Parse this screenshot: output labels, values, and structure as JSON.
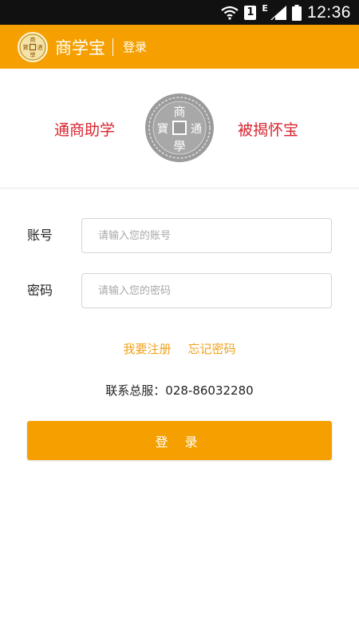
{
  "status_bar": {
    "time": "12:36",
    "sim_slot": "1",
    "network_type": "E",
    "icons": [
      "wifi-icon",
      "sim-icon",
      "signal-icon",
      "battery-icon"
    ]
  },
  "app_bar": {
    "app_name": "商学宝",
    "page_title": "登录",
    "logo_chars": [
      "商",
      "寶",
      "通",
      "學"
    ]
  },
  "banner": {
    "slogan_left": "通商助学",
    "slogan_right": "被揭怀宝",
    "seal_chars": [
      "商",
      "寶",
      "通",
      "學"
    ]
  },
  "form": {
    "account_label": "账号",
    "account_placeholder": "请输入您的账号",
    "account_value": "",
    "password_label": "密码",
    "password_placeholder": "请输入您的密码",
    "password_value": ""
  },
  "links": {
    "register": "我要注册",
    "forgot_password": "忘记密码"
  },
  "contact": "联系总服：028-86032280",
  "login_button": "登 录",
  "colors": {
    "brand_orange": "#f5a000",
    "link_orange": "#f0a21b",
    "slogan_red": "#d9232e",
    "status_bar": "#111111"
  }
}
